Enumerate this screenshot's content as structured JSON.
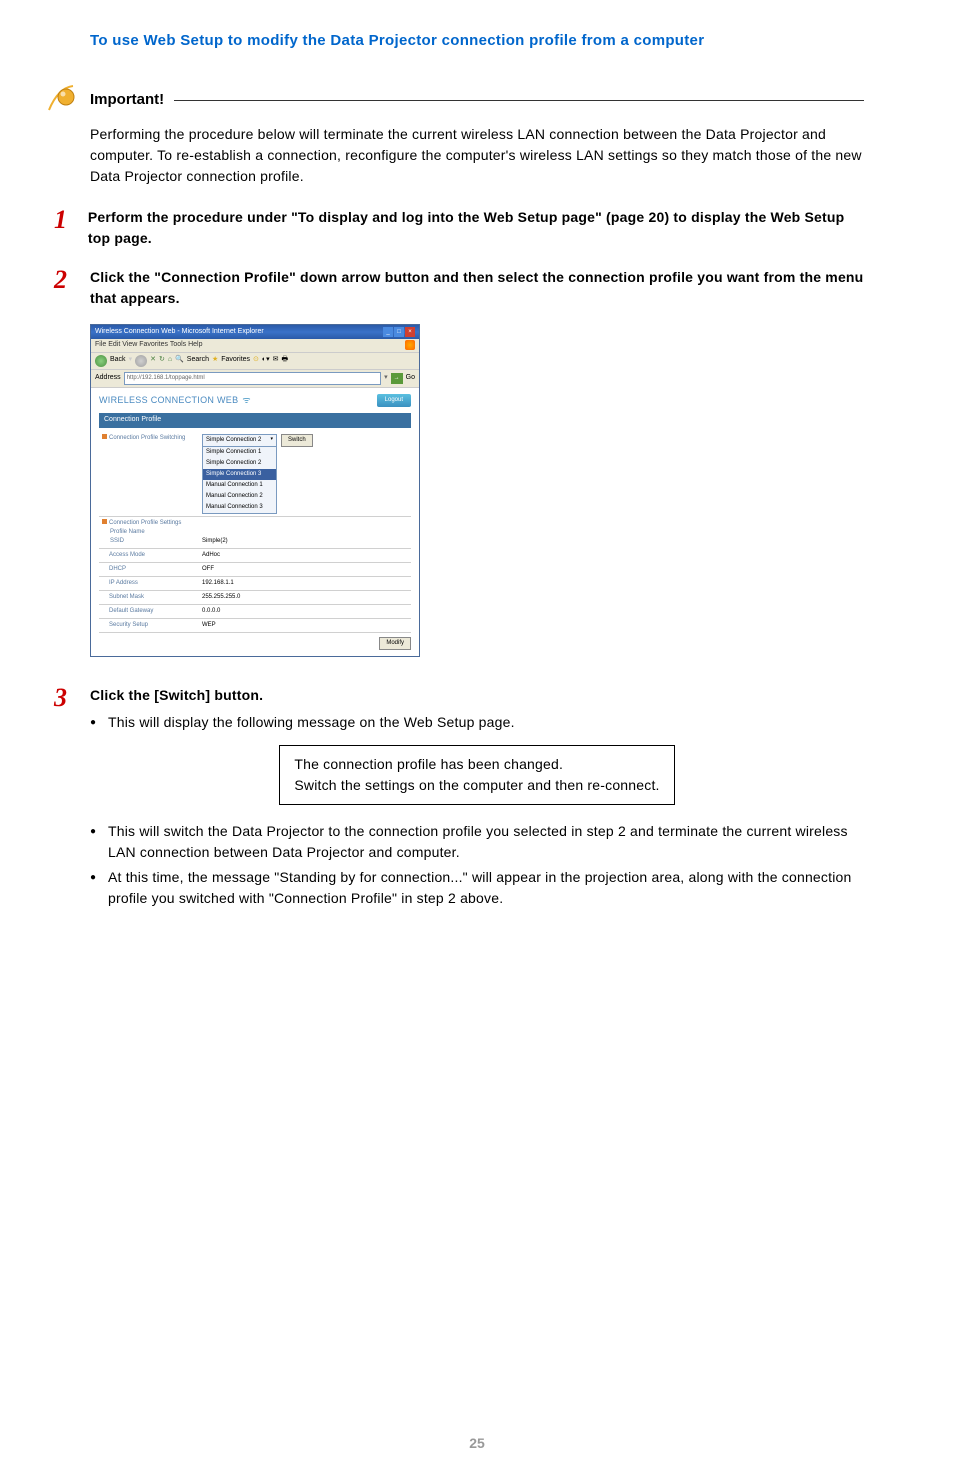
{
  "section_title": "To use Web Setup to modify the Data Projector connection profile from a computer",
  "important": {
    "label": "Important!",
    "body": "Performing the procedure below will terminate the current wireless LAN connection between the Data Projector and computer. To re-establish a connection, reconfigure the computer's wireless LAN settings so they match those of the new Data Projector connection profile."
  },
  "steps": {
    "s1": {
      "num": "1",
      "title": "Perform the procedure under \"To display and log into the Web Setup page\" (page 20) to display the Web Setup top page."
    },
    "s2": {
      "num": "2",
      "title": "Click the \"Connection Profile\" down arrow button and then select the connection profile you want from the menu that appears."
    },
    "s3": {
      "num": "3",
      "title": "Click the [Switch] button.",
      "bullets": {
        "b1": "This will display the following message on the Web Setup page.",
        "b2": "This will switch the Data Projector to the connection profile you selected in step 2 and terminate the current wireless LAN connection between Data Projector and computer.",
        "b3": "At this time, the message \"Standing by for connection...\" will appear in the projection area, along with the connection profile you switched with \"Connection Profile\" in step 2 above."
      }
    }
  },
  "message_box": {
    "line1": "The connection profile has been changed.",
    "line2": "Switch the settings on the computer and then re-connect."
  },
  "ie": {
    "title": "Wireless Connection Web - Microsoft Internet Explorer",
    "menu": "File   Edit   View   Favorites   Tools   Help",
    "toolbar": {
      "back": "Back",
      "search": "Search",
      "favorites": "Favorites"
    },
    "address_label": "Address",
    "address_url": "http://192.168.1/toppage.html",
    "go": "Go"
  },
  "web": {
    "title": "WIRELESS CONNECTION WEB",
    "logout": "Logout",
    "section": "Connection Profile",
    "switching_label": "Connection Profile Switching",
    "dropdown_selected": "Simple Connection 2",
    "dropdown_options": {
      "o1": "Simple Connection 1",
      "o2": "Simple Connection 2",
      "o3": "Simple Connection 3",
      "o4": "Manual Connection 1",
      "o5": "Manual Connection 2",
      "o6": "Manual Connection 3"
    },
    "switch_btn": "Switch",
    "settings_label": "Connection Profile Settings",
    "rows": {
      "profile_name_label": "Profile Name",
      "profile_name_value": "Simple(2)",
      "ssid_label": "SSID",
      "ssid_value": "",
      "access_mode_label": "Access Mode",
      "access_mode_value": "AdHoc",
      "dhcp_label": "DHCP",
      "dhcp_value": "OFF",
      "ip_label": "IP Address",
      "ip_value": "192.168.1.1",
      "subnet_label": "Subnet Mask",
      "subnet_value": "255.255.255.0",
      "gateway_label": "Default Gateway",
      "gateway_value": "0.0.0.0",
      "security_label": "Security Setup",
      "security_value": "WEP"
    },
    "modify_btn": "Modify"
  },
  "page_number": "25"
}
